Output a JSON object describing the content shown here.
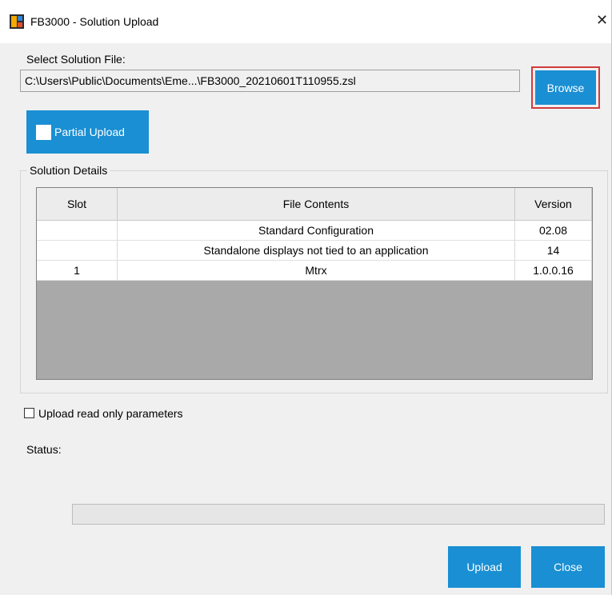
{
  "window": {
    "title": "FB3000 - Solution Upload",
    "close_glyph": "✕"
  },
  "file": {
    "label": "Select Solution File:",
    "path": "C:\\Users\\Public\\Documents\\Eme...\\FB3000_20210601T110955.zsl",
    "browse_label": "Browse"
  },
  "partial_upload_label": "Partial Upload",
  "details": {
    "legend": "Solution Details",
    "columns": [
      "Slot",
      "File Contents",
      "Version"
    ],
    "rows": [
      {
        "slot": "",
        "contents": "Standard Configuration",
        "version": "02.08"
      },
      {
        "slot": "",
        "contents": "Standalone displays not tied to an application",
        "version": "14"
      },
      {
        "slot": "1",
        "contents": "Mtrx",
        "version": "1.0.0.16"
      }
    ]
  },
  "options": {
    "readonly_label": "Upload read only parameters",
    "readonly_checked": false
  },
  "status": {
    "label": "Status:",
    "progress": 0
  },
  "buttons": {
    "upload": "Upload",
    "close": "Close"
  },
  "colors": {
    "accent": "#1a8fd3",
    "highlight": "#d23b3b"
  },
  "icons": {
    "app": "fb3000-app-icon",
    "close": "close-icon"
  }
}
